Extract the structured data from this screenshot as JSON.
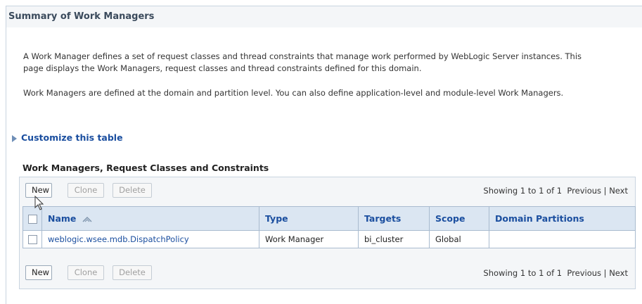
{
  "section": {
    "title": "Summary of Work Managers"
  },
  "description": {
    "para1_line1": "A Work Manager defines a set of request classes and thread constraints that manage work performed by WebLogic Server instances. This",
    "para1_line2": "page displays the Work Managers, request classes and thread constraints defined for this domain.",
    "para2": "Work Managers are defined at the domain and partition level. You can also define application-level and module-level Work Managers."
  },
  "customize": {
    "label": "Customize this table"
  },
  "table": {
    "title": "Work Managers, Request Classes and Constraints",
    "buttons": {
      "new": "New",
      "clone": "Clone",
      "delete": "Delete"
    },
    "paging": {
      "showing": "Showing 1 to 1 of 1",
      "previous": "Previous",
      "separator": "|",
      "next": "Next"
    },
    "columns": {
      "name": "Name",
      "type": "Type",
      "targets": "Targets",
      "scope": "Scope",
      "partitions": "Domain Partitions"
    },
    "rows": [
      {
        "name": "weblogic.wsee.mdb.DispatchPolicy",
        "type": "Work Manager",
        "targets": "bi_cluster",
        "scope": "Global",
        "partitions": ""
      }
    ]
  },
  "colors": {
    "link": "#1a4e9f",
    "header_bg": "#dbe6f2",
    "panel_bg": "#f4f6f8",
    "border": "#a9bbcf"
  },
  "icons": {
    "customize": "triangle-right-icon",
    "sort": "sort-ascending-icon",
    "pointer": "mouse-pointer-icon"
  }
}
